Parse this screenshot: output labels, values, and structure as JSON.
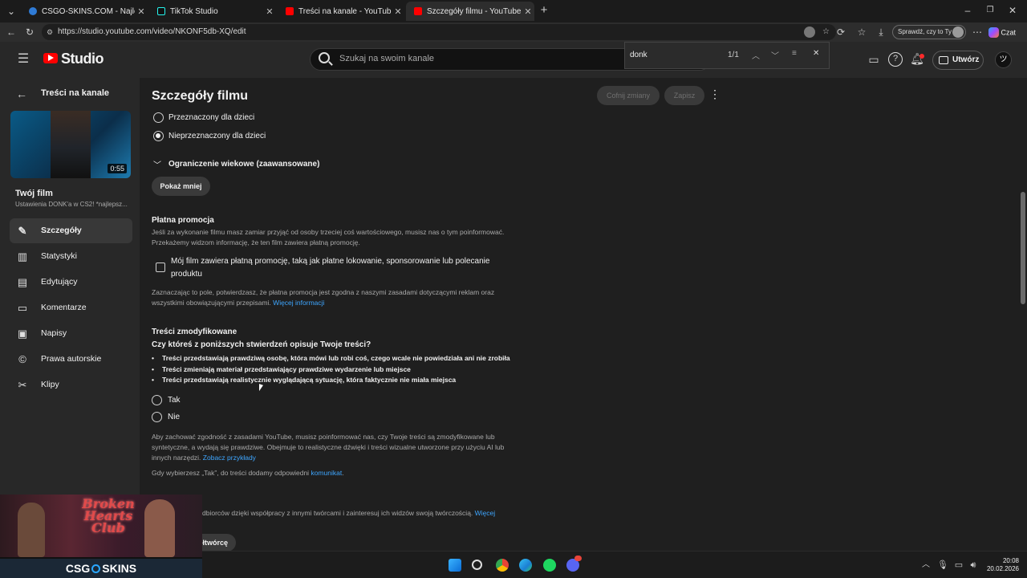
{
  "browser": {
    "tabs": [
      {
        "title": "CSGO-SKINS.COM - Najlepsze Sk",
        "active": false
      },
      {
        "title": "TikTok Studio",
        "active": false
      },
      {
        "title": "Treści na kanale - YouTube Studio",
        "active": false
      },
      {
        "title": "Szczegóły filmu - YouTube Studio",
        "active": true
      }
    ],
    "url": "https://studio.youtube.com/video/NKONF5db-XQ/edit",
    "check_button": "Sprawdź, czy to Ty",
    "chat_label": "Czat"
  },
  "find_bar": {
    "query": "donk",
    "count": "1/1"
  },
  "header": {
    "logo": "Studio",
    "search_placeholder": "Szukaj na swoim kanale",
    "create_label": "Utwórz"
  },
  "sidebar": {
    "back_label": "Treści na kanale",
    "duration": "0:55",
    "film_title": "Twój film",
    "film_subtitle": "Ustawienia DONK'a w CS2! *najlepsz...",
    "items": [
      {
        "label": "Szczegóły",
        "icon": "pencil-icon",
        "active": true
      },
      {
        "label": "Statystyki",
        "icon": "analytics-icon",
        "active": false
      },
      {
        "label": "Edytujący",
        "icon": "editor-icon",
        "active": false
      },
      {
        "label": "Komentarze",
        "icon": "comments-icon",
        "active": false
      },
      {
        "label": "Napisy",
        "icon": "subtitles-icon",
        "active": false
      },
      {
        "label": "Prawa autorskie",
        "icon": "copyright-icon",
        "active": false
      },
      {
        "label": "Klipy",
        "icon": "scissors-icon",
        "active": false
      }
    ]
  },
  "main": {
    "title": "Szczegóły filmu",
    "undo_label": "Cofnij zmiany",
    "save_label": "Zapisz",
    "audience": {
      "option_kids": "Przeznaczony dla dzieci",
      "option_not_kids": "Nieprzeznaczony dla dzieci",
      "selected": "option_not_kids"
    },
    "age_restriction": "Ograniczenie wiekowe (zaawansowane)",
    "show_less": "Pokaż mniej",
    "paid_promo": {
      "heading": "Płatna promocja",
      "desc_line1": "Jeśli za wykonanie filmu masz zamiar przyjąć od osoby trzeciej coś wartościowego, musisz nas o tym poinformować.",
      "desc_line2": "Przekażemy widzom informację, że ten film zawiera płatną promocję.",
      "checkbox_line1": "Mój film zawiera płatną promocję, taką jak płatne lokowanie, sponsorowanie lub polecanie",
      "checkbox_line2": "produktu",
      "checked": false,
      "note_line1": "Zaznaczając to pole, potwierdzasz, że płatna promocja jest zgodna z naszymi zasadami dotyczącymi reklam oraz",
      "note_line2": "wszystkimi obowiązującymi przepisami.",
      "more_link": "Więcej informacji"
    },
    "altered": {
      "heading": "Treści zmodyfikowane",
      "question": "Czy któreś z poniższych stwierdzeń opisuje Twoje treści?",
      "bullets": [
        "Treści przedstawiają prawdziwą osobę, która mówi lub robi coś, czego wcale nie powiedziała ani nie zrobiła",
        "Treści zmieniają materiał przedstawiający prawdziwe wydarzenie lub miejsce",
        "Treści przedstawiają realistycznie wyglądającą sytuację, która faktycznie nie miała miejsca"
      ],
      "option_yes": "Tak",
      "option_no": "Nie",
      "info_line1": "Aby zachować zgodność z zasadami YouTube, musisz poinformować nas, czy Twoje treści są zmodyfikowane lub",
      "info_line2": "syntetyczne, a wydają się prawdziwe. Obejmuje to realistyczne dźwięki i treści wizualne utworzone przy użyciu AI lub",
      "info_line3": "innych narzędzi.",
      "examples_link": "Zobacz przykłady",
      "label_line_prefix": "Gdy wybierzesz „Tak”, do treści dodamy odpowiedni",
      "label_link": "komunikat",
      "label_line_suffix": "."
    },
    "collab_line": "dbiorców dzięki współpracy z innymi twórcami i zainteresuj ich widzów swoją twórczością.",
    "collab_link": "Więcej",
    "collab_button": "ołtwórcę"
  },
  "overlay": {
    "club_line1": "Broken Hearts",
    "club_line2": "Club",
    "brand": "CSG",
    "brand_suffix": "SKINS"
  },
  "taskbar": {
    "time": "20:08",
    "date": "20.02.2026"
  },
  "colors": {
    "accent_link": "#3ea6ff",
    "youtube_red": "#ff0000",
    "background": "#1f1f1f"
  }
}
